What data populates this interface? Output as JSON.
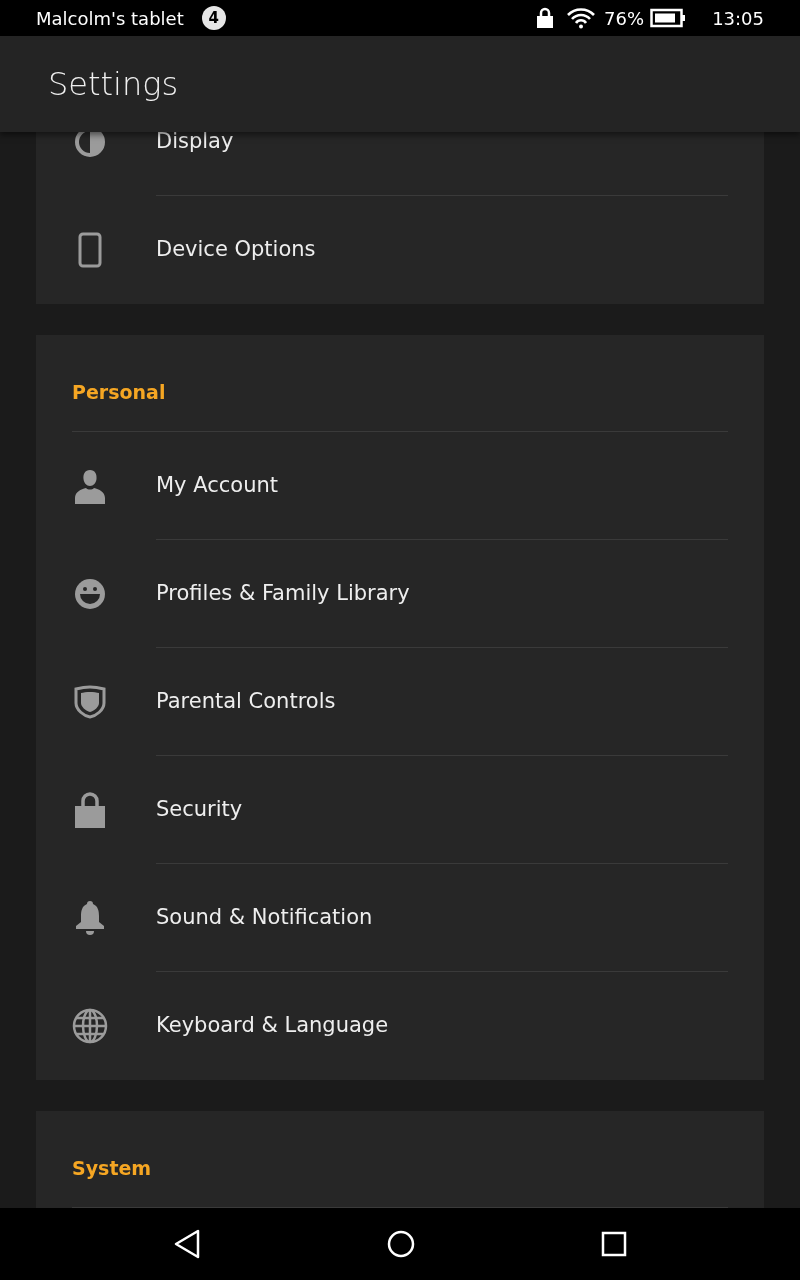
{
  "status_bar": {
    "device_name": "Malcolm's tablet",
    "notification_count": "4",
    "battery": "76%",
    "time": "13:05"
  },
  "app_bar": {
    "title": "Settings"
  },
  "sections": [
    {
      "items": [
        {
          "label": "Display"
        },
        {
          "label": "Device Options"
        }
      ]
    },
    {
      "header": "Personal",
      "items": [
        {
          "label": "My Account"
        },
        {
          "label": "Profiles & Family Library"
        },
        {
          "label": "Parental Controls"
        },
        {
          "label": "Security"
        },
        {
          "label": "Sound & Notification"
        },
        {
          "label": "Keyboard & Language"
        }
      ]
    },
    {
      "header": "System"
    }
  ]
}
